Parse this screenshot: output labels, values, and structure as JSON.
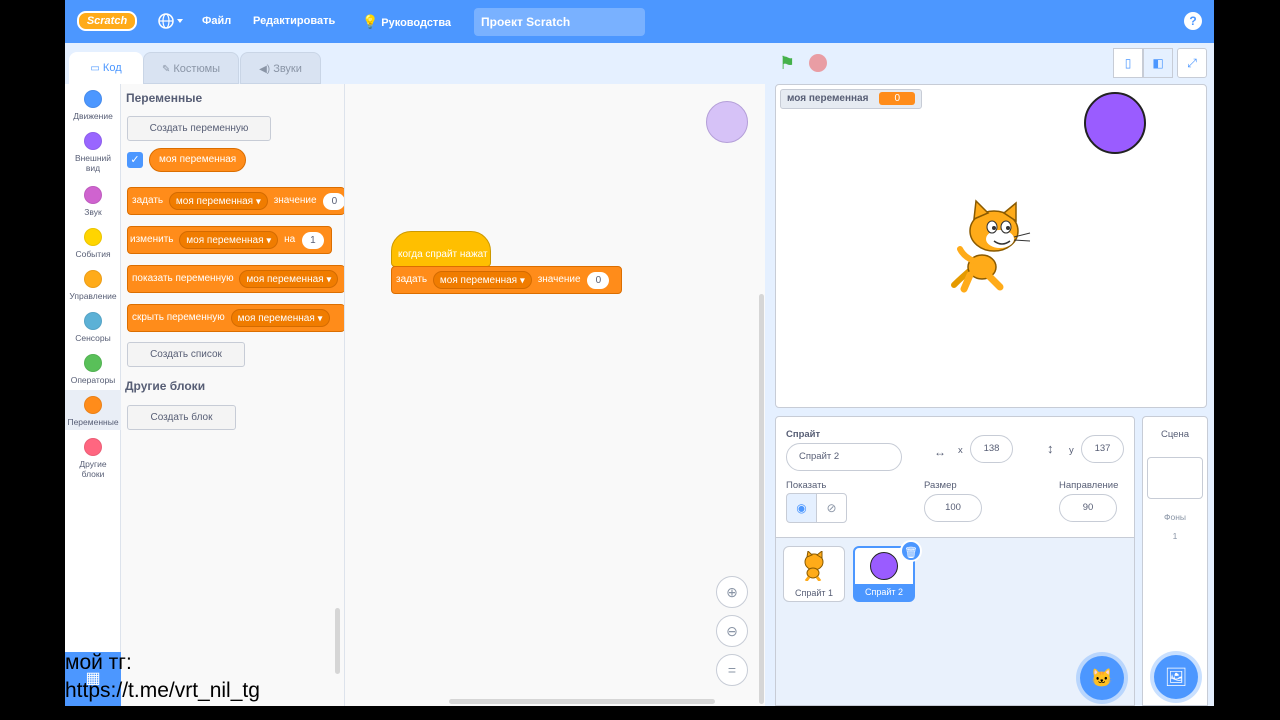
{
  "topbar": {
    "logo": "Scratch",
    "menu_file": "Файл",
    "menu_edit": "Редактировать",
    "menu_tutorials": "Руководства",
    "project_title": "Проект Scratch",
    "help": "?"
  },
  "tabs": {
    "code": "Код",
    "costumes": "Костюмы",
    "sounds": "Звуки"
  },
  "categories": [
    {
      "label": "Движение",
      "color": "#4c97ff"
    },
    {
      "label": "Внешний вид",
      "color": "#9966ff"
    },
    {
      "label": "Звук",
      "color": "#cf63cf"
    },
    {
      "label": "События",
      "color": "#ffd500"
    },
    {
      "label": "Управление",
      "color": "#ffab19"
    },
    {
      "label": "Сенсоры",
      "color": "#5cb1d6"
    },
    {
      "label": "Операторы",
      "color": "#59c059"
    },
    {
      "label": "Переменные",
      "color": "#ff8c1a"
    },
    {
      "label": "Другие блоки",
      "color": "#ff6680"
    }
  ],
  "palette": {
    "heading_variables": "Переменные",
    "make_variable": "Создать переменную",
    "variable_name": "моя переменная",
    "block_set": {
      "verb": "задать",
      "var": "моя переменная",
      "word": "значение",
      "value": "0"
    },
    "block_change": {
      "verb": "изменить",
      "var": "моя переменная",
      "word": "на",
      "value": "1"
    },
    "block_show": {
      "verb": "показать переменную",
      "var": "моя переменная"
    },
    "block_hide": {
      "verb": "скрыть переменную",
      "var": "моя переменная"
    },
    "make_list": "Создать список",
    "heading_more": "Другие блоки",
    "make_block": "Создать блок"
  },
  "workspace": {
    "hat_label": "когда спрайт нажат",
    "set_block": {
      "verb": "задать",
      "var": "моя переменная",
      "word": "значение",
      "value": "0"
    }
  },
  "stage": {
    "monitor_label": "моя переменная",
    "monitor_value": "0"
  },
  "sprite_info": {
    "label_sprite": "Спрайт",
    "name": "Спрайт 2",
    "x_label": "x",
    "x": "138",
    "y_label": "y",
    "y": "137",
    "show_label": "Показать",
    "size_label": "Размер",
    "size": "100",
    "direction_label": "Направление",
    "direction": "90"
  },
  "sprites": [
    {
      "name": "Спрайт 1",
      "selected": false
    },
    {
      "name": "Спрайт 2",
      "selected": true
    }
  ],
  "scene": {
    "label": "Сцена",
    "backdrops_label": "Фоны",
    "backdrops_count": "1"
  },
  "overlay": {
    "line1": "мой тг:",
    "line2": "https://t.me/vrt_nil_tg"
  }
}
